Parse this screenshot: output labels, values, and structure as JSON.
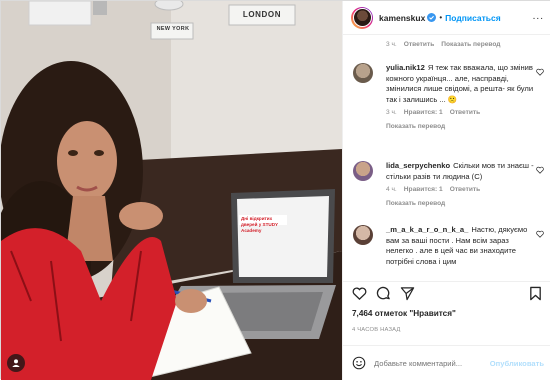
{
  "header": {
    "username": "kamenskux",
    "follow_label": "Подписаться",
    "more_label": "..."
  },
  "first_comment_meta": {
    "time": "3 ч.",
    "reply": "Ответить",
    "view_translation": "Показать перевод"
  },
  "comments": [
    {
      "user": "yulia.nik12",
      "text": "Я теж так вважала, що змінив кожного українця... але, насправді, змінилися лише свідомі, а решта- як були так і залишись ...",
      "emoji": "🙁",
      "time": "3 ч.",
      "likes": "Нравится: 1",
      "reply": "Ответить",
      "view_translation": "Показать перевод"
    },
    {
      "user": "lida_serpychenko",
      "text": "Скільки мов ти знаєш - стільки разів ти людина (С)",
      "time": "4 ч.",
      "likes": "Нравится: 1",
      "reply": "Ответить",
      "view_translation": "Показать перевод"
    },
    {
      "user": "_m_a_k_a_r_o_n_k_a_",
      "text": "Настю, дякуємо вам за ваші пости . Нам всім зараз нелегко . але в цей час ви знаходите потрібні слова і цим"
    }
  ],
  "likes_text": "7,464 отметок \"Нравится\"",
  "time_ago": "4 ЧАСОВ НАЗАД",
  "comment_box": {
    "placeholder": "Добавьте комментарий...",
    "publish_label": "Опубликовать"
  },
  "photo": {
    "signs": [
      "NEW YORK",
      "LONDON"
    ],
    "laptop_text": "Дні відкритих дверей у STUDY Academy"
  },
  "colors": {
    "accent": "#0095f6",
    "muted": "#8e8e8e",
    "shirt": "#d3202a"
  },
  "icons": [
    "heart-icon",
    "comment-icon",
    "share-icon",
    "bookmark-icon",
    "emoji-icon",
    "verified-icon",
    "user-tag-icon"
  ]
}
